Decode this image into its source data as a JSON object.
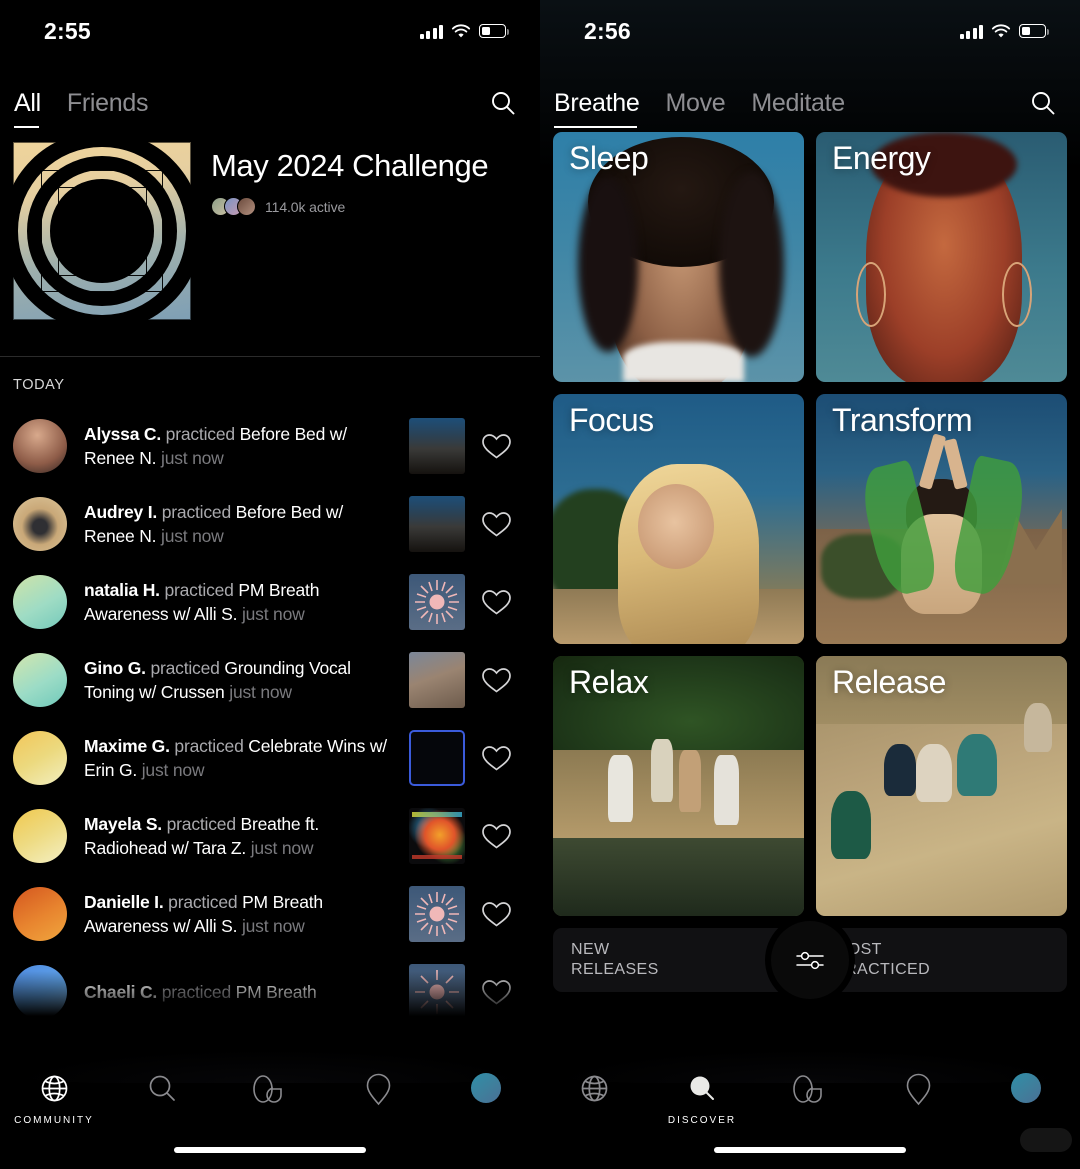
{
  "left": {
    "status": {
      "time": "2:55",
      "signal_icon": "cellular-bars-icon",
      "wifi_icon": "wifi-icon",
      "battery_icon": "battery-icon"
    },
    "tabs": [
      {
        "label": "All",
        "active": true
      },
      {
        "label": "Friends",
        "active": false
      }
    ],
    "search_icon": "search-icon",
    "challenge": {
      "title": "May 2024 Challenge",
      "active_count": "114.0k active",
      "artwork_name": "challenge-artwork",
      "gradient_top": "#efd49b",
      "gradient_bottom": "#7e9fb5"
    },
    "section_header": "TODAY",
    "feed": [
      {
        "user": "Alyssa C.",
        "action": "practiced",
        "title": "Before Bed",
        "with": "w/ Renee N.",
        "time": "just now",
        "avatar": "photo",
        "thumb": "mountain"
      },
      {
        "user": "Audrey I.",
        "action": "practiced",
        "title": "Before Bed",
        "with": "w/ Renee N.",
        "time": "just now",
        "avatar": "photo-dog",
        "thumb": "mountain"
      },
      {
        "user": "natalia H.",
        "action": "practiced",
        "title": "PM Breath Awareness",
        "with": "w/ Alli S.",
        "time": "just now",
        "avatar": "gradient-mint",
        "thumb": "starburst"
      },
      {
        "user": "Gino G.",
        "action": "practiced",
        "title": "Grounding Vocal Toning",
        "with": "w/ Crussen",
        "time": "just now",
        "avatar": "gradient-mint",
        "thumb": "rock"
      },
      {
        "user": "Maxime G.",
        "action": "practiced",
        "title": "Celebrate Wins",
        "with": "w/ Erin G.",
        "time": "just now",
        "avatar": "gradient-gold",
        "thumb": "blue-frame"
      },
      {
        "user": "Mayela S.",
        "action": "practiced",
        "title": "Breathe ft. Radiohead",
        "with": "w/ Tara Z.",
        "time": "just now",
        "avatar": "gradient-gold",
        "thumb": "album-art"
      },
      {
        "user": "Danielle I.",
        "action": "practiced",
        "title": "PM Breath Awareness",
        "with": "w/ Alli S.",
        "time": "just now",
        "avatar": "gradient-orange",
        "thumb": "starburst"
      },
      {
        "user": "Chaeli C.",
        "action": "practiced",
        "title": "PM Breath",
        "with": "",
        "time": "",
        "avatar": "gradient-blue",
        "thumb": "starburst"
      }
    ],
    "like_icon": "heart-icon",
    "tabbar": [
      {
        "icon": "globe-icon",
        "label": "COMMUNITY",
        "active": true
      },
      {
        "icon": "search-icon",
        "label": "",
        "active": false
      },
      {
        "icon": "breathe-icon",
        "label": "",
        "active": false
      },
      {
        "icon": "location-pin-icon",
        "label": "",
        "active": false
      },
      {
        "icon": "avatar-icon",
        "label": "",
        "active": false
      }
    ]
  },
  "right": {
    "status": {
      "time": "2:56",
      "signal_icon": "cellular-bars-icon",
      "wifi_icon": "wifi-icon",
      "battery_icon": "battery-icon"
    },
    "tabs": [
      {
        "label": "Breathe",
        "active": true
      },
      {
        "label": "Move",
        "active": false
      },
      {
        "label": "Meditate",
        "active": false
      }
    ],
    "search_icon": "search-icon",
    "cards": [
      {
        "label": "Sleep"
      },
      {
        "label": "Energy"
      },
      {
        "label": "Focus"
      },
      {
        "label": "Transform"
      },
      {
        "label": "Relax"
      },
      {
        "label": "Release"
      }
    ],
    "strips": [
      {
        "line1": "NEW",
        "line2": "RELEASES"
      },
      {
        "line1": "MOST",
        "line2": "PRACTICED"
      }
    ],
    "filter_icon": "sliders-icon",
    "tabbar": [
      {
        "icon": "globe-icon",
        "label": "",
        "active": false
      },
      {
        "icon": "search-icon",
        "label": "DISCOVER",
        "active": true
      },
      {
        "icon": "breathe-icon",
        "label": "",
        "active": false
      },
      {
        "icon": "location-pin-icon",
        "label": "",
        "active": false
      },
      {
        "icon": "avatar-icon",
        "label": "",
        "active": false
      }
    ]
  }
}
